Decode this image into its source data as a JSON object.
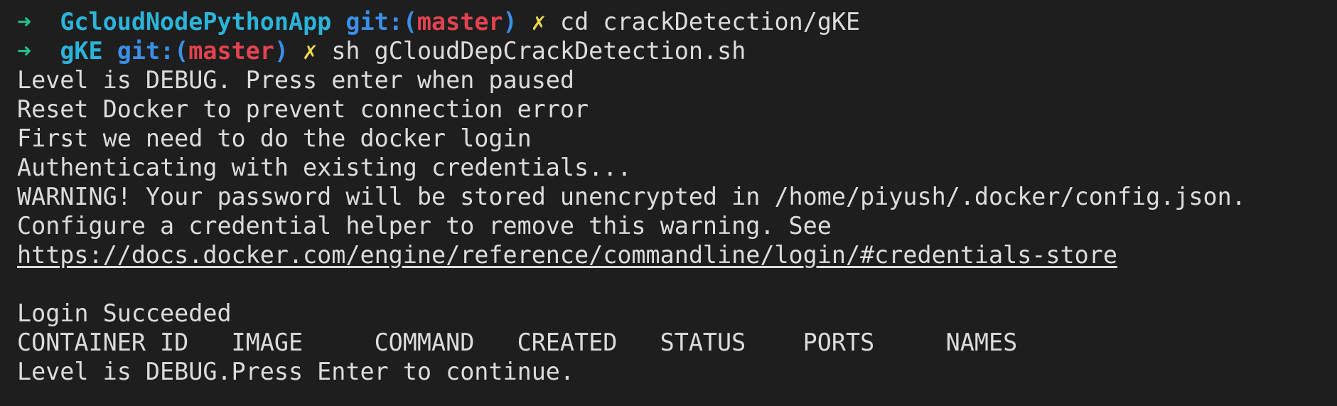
{
  "prompt1": {
    "arrow": "➜",
    "dir": "GcloudNodePythonApp",
    "git_open": "git:(",
    "branch": "master",
    "git_close": ")",
    "dirty": "✗",
    "command": "cd crackDetection/gKE"
  },
  "prompt2": {
    "arrow": "➜",
    "dir": "gKE",
    "git_open": "git:(",
    "branch": "master",
    "git_close": ")",
    "dirty": "✗",
    "command": "sh gCloudDepCrackDetection.sh"
  },
  "output": {
    "line1": "Level is DEBUG. Press enter when paused",
    "line2": "Reset Docker to prevent connection error",
    "line3": "First we need to do the docker login",
    "line4": "Authenticating with existing credentials...",
    "line5": "WARNING! Your password will be stored unencrypted in /home/piyush/.docker/config.json.",
    "line6": "Configure a credential helper to remove this warning. See",
    "link": "https://docs.docker.com/engine/reference/commandline/login/#credentials-store",
    "line8": "Login Succeeded",
    "table_header": "CONTAINER ID   IMAGE     COMMAND   CREATED   STATUS    PORTS     NAMES",
    "line10": "Level is DEBUG.Press Enter to continue."
  }
}
